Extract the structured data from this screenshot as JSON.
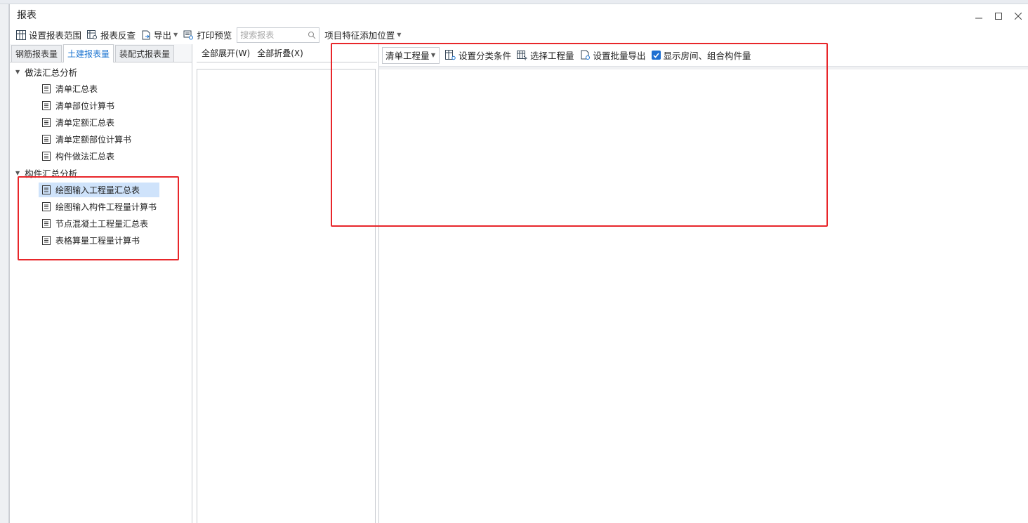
{
  "window": {
    "title": "报表"
  },
  "toolbar": {
    "set_range": "设置报表范围",
    "reverse_check": "报表反查",
    "export": "导出",
    "print_preview": "打印预览",
    "search_placeholder": "搜索报表",
    "feature_position": "项目特征添加位置"
  },
  "tabs": [
    {
      "label": "钢筋报表量",
      "active": false
    },
    {
      "label": "土建报表量",
      "active": true
    },
    {
      "label": "装配式报表量",
      "active": false
    }
  ],
  "tree": {
    "groups": [
      {
        "label": "做法汇总分析",
        "items": [
          "清单汇总表",
          "清单部位计算书",
          "清单定额汇总表",
          "清单定额部位计算书",
          "构件做法汇总表"
        ]
      },
      {
        "label": "构件汇总分析",
        "items": [
          "绘图输入工程量汇总表",
          "绘图输入构件工程量计算书",
          "节点混凝土工程量汇总表",
          "表格算量工程量计算书"
        ]
      }
    ],
    "selected": "绘图输入工程量汇总表"
  },
  "middle": {
    "expand_all": "全部展开(W)",
    "collapse_all": "全部折叠(X)"
  },
  "right": {
    "select_value": "清单工程量",
    "set_category": "设置分类条件",
    "select_quantity": "选择工程量",
    "batch_export": "设置批量导出",
    "show_room_label": "显示房间、组合构件量",
    "show_room_checked": true
  },
  "colors": {
    "accent": "#1a73d0",
    "highlight_box": "#e8262a",
    "selected_bg": "#cfe3fb"
  }
}
